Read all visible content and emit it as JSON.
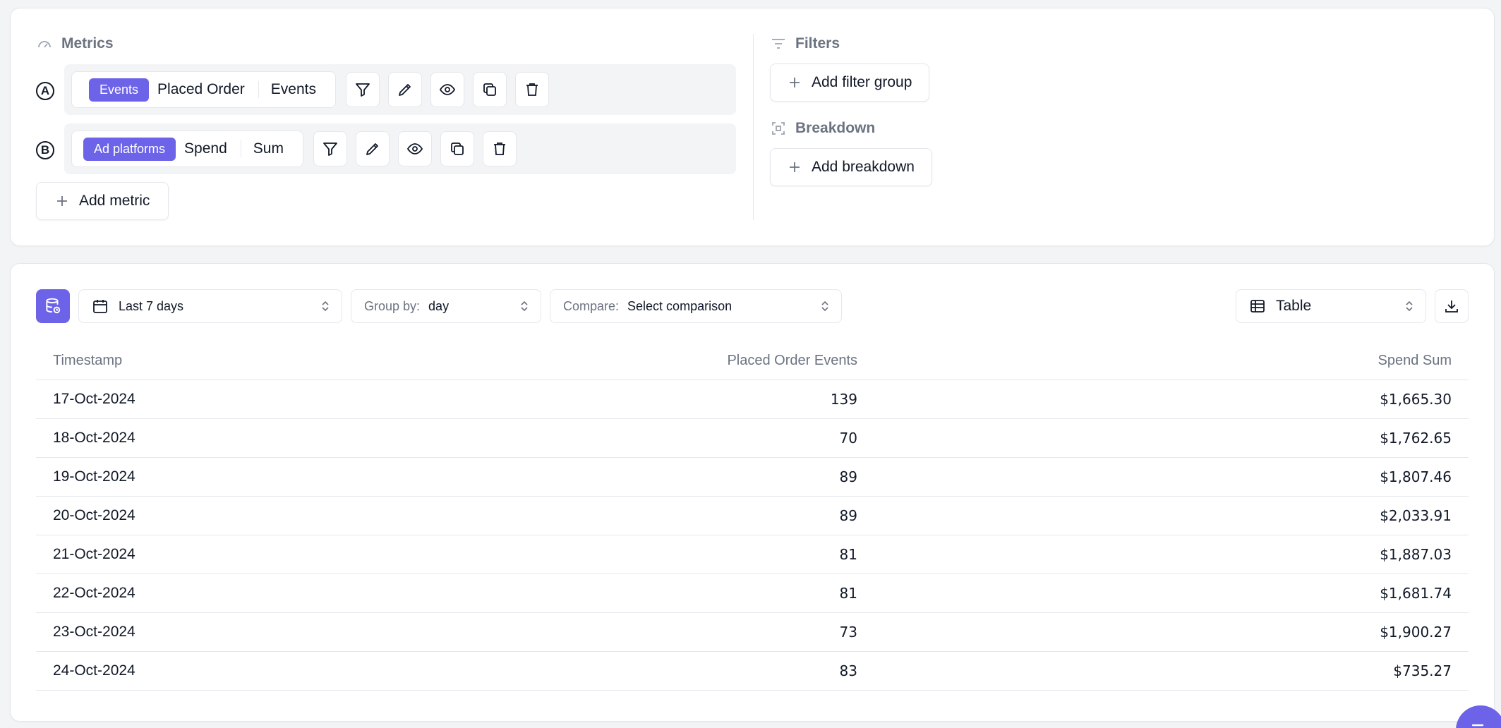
{
  "metrics": {
    "title": "Metrics",
    "add_metric_label": "Add metric",
    "items": [
      {
        "letter": "A",
        "tag": "Events",
        "name": "Placed Order",
        "aggregation": "Events"
      },
      {
        "letter": "B",
        "tag": "Ad platforms",
        "name": "Spend",
        "aggregation": "Sum"
      }
    ]
  },
  "filters": {
    "title": "Filters",
    "add_label": "Add filter group"
  },
  "breakdown": {
    "title": "Breakdown",
    "add_label": "Add breakdown"
  },
  "toolbar": {
    "date_range": "Last 7 days",
    "group_by_label": "Group by:",
    "group_by_value": "day",
    "compare_label": "Compare:",
    "compare_value": "Select comparison",
    "view_value": "Table"
  },
  "table": {
    "headers": [
      "Timestamp",
      "Placed Order Events",
      "Spend Sum"
    ],
    "rows": [
      [
        "17-Oct-2024",
        "139",
        "$1,665.30"
      ],
      [
        "18-Oct-2024",
        "70",
        "$1,762.65"
      ],
      [
        "19-Oct-2024",
        "89",
        "$1,807.46"
      ],
      [
        "20-Oct-2024",
        "89",
        "$2,033.91"
      ],
      [
        "21-Oct-2024",
        "81",
        "$1,887.03"
      ],
      [
        "22-Oct-2024",
        "81",
        "$1,681.74"
      ],
      [
        "23-Oct-2024",
        "73",
        "$1,900.27"
      ],
      [
        "24-Oct-2024",
        "83",
        "$735.27"
      ]
    ]
  },
  "colors": {
    "accent": "#6d63e8",
    "border": "#e5e7eb",
    "muted": "#6b7280"
  }
}
